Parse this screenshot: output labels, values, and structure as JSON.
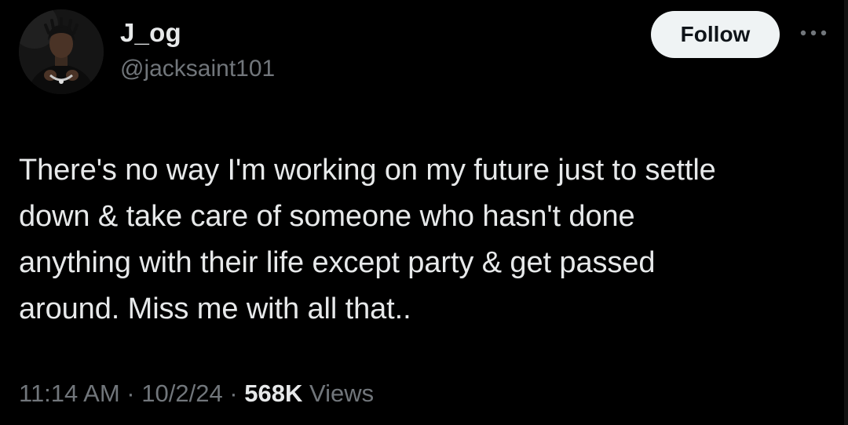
{
  "user": {
    "display_name": "J_og",
    "handle": "@jacksaint101"
  },
  "actions": {
    "follow_label": "Follow",
    "more_icon": "more-horizontal-icon"
  },
  "tweet": {
    "text": "There's no way I'm working on my future just to settle\ndown & take care of someone who hasn't done\nanything with their life except party & get passed\naround. Miss me with all that.."
  },
  "meta": {
    "time": "11:14 AM",
    "separator": " · ",
    "date": "10/2/24",
    "views_count": "568K",
    "views_label": " Views"
  },
  "colors": {
    "background": "#000000",
    "primary_text": "#e7e9ea",
    "secondary_text": "#71767b",
    "follow_button_bg": "#eff3f4",
    "follow_button_text": "#0f1419"
  }
}
